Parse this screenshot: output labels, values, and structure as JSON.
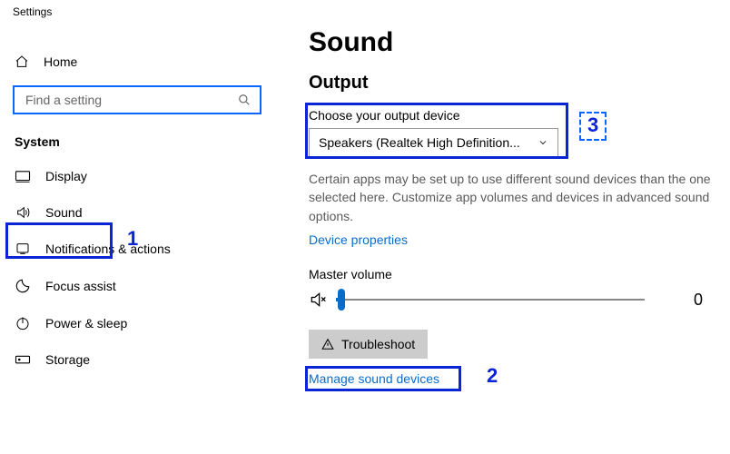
{
  "window": {
    "title": "Settings"
  },
  "home": {
    "label": "Home"
  },
  "search": {
    "placeholder": "Find a setting"
  },
  "section": {
    "label": "System"
  },
  "nav": {
    "display": "Display",
    "sound": "Sound",
    "notifications": "Notifications & actions",
    "focus": "Focus assist",
    "power": "Power & sleep",
    "storage": "Storage"
  },
  "page": {
    "title": "Sound",
    "output_heading": "Output",
    "choose_label": "Choose your output device",
    "device_selected": "Speakers (Realtek High Definition...",
    "desc": "Certain apps may be set up to use different sound devices than the one selected here. Customize app volumes and devices in advanced sound options.",
    "device_properties": "Device properties",
    "master_volume_label": "Master volume",
    "volume_value": "0",
    "troubleshoot": "Troubleshoot",
    "manage": "Manage sound devices"
  },
  "annotations": {
    "a1": "1",
    "a2": "2",
    "a3": "3"
  }
}
